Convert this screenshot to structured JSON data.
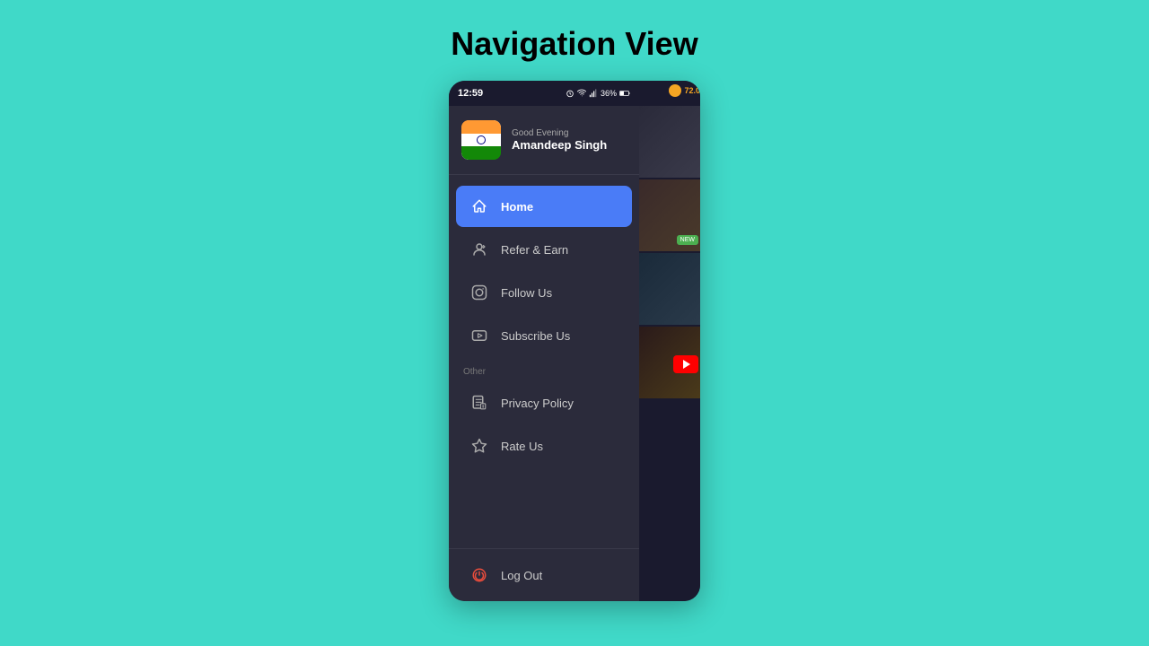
{
  "page": {
    "title": "Navigation View",
    "background": "#40d9c8"
  },
  "statusBar": {
    "time": "12:59",
    "battery": "36%"
  },
  "userHeader": {
    "greeting": "Good Evening",
    "username": "Amandeep Singh"
  },
  "coinValue": "72.0",
  "navItems": [
    {
      "id": "home",
      "label": "Home",
      "active": true
    },
    {
      "id": "refer",
      "label": "Refer & Earn",
      "active": false
    },
    {
      "id": "follow",
      "label": "Follow Us",
      "active": false
    },
    {
      "id": "subscribe",
      "label": "Subscribe Us",
      "active": false
    }
  ],
  "sectionLabel": "Other",
  "otherItems": [
    {
      "id": "privacy",
      "label": "Privacy Policy"
    },
    {
      "id": "rate",
      "label": "Rate Us"
    }
  ],
  "bottomItem": {
    "label": "Log Out"
  }
}
